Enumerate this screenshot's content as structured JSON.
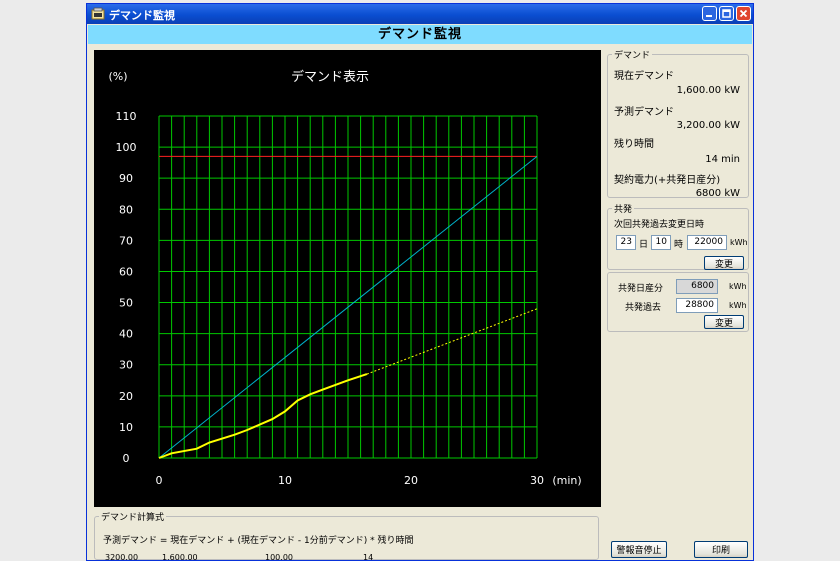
{
  "window": {
    "title": "デマンド監視"
  },
  "header": {
    "title": "デマンド監視"
  },
  "chart_data": {
    "type": "line",
    "title": "デマンド表示",
    "ylabel": "(%)",
    "xlabel": "(min)",
    "xlim": [
      0,
      30
    ],
    "ylim": [
      0,
      110
    ],
    "x_ticks": [
      0,
      10,
      20,
      30
    ],
    "y_ticks": [
      0,
      10,
      20,
      30,
      40,
      50,
      60,
      70,
      80,
      90,
      100,
      110
    ],
    "grid": true,
    "colors": {
      "background": "#000000",
      "grid": "#00c800",
      "limit": "#ff2020",
      "diagonal": "#00b0c8",
      "actual": "#ffff00",
      "projection": "#ffff00",
      "axis_text": "#ffffff"
    },
    "series": [
      {
        "style": "limit",
        "x": [
          0,
          30
        ],
        "y": [
          97,
          97
        ]
      },
      {
        "style": "diagonal",
        "x": [
          0,
          30
        ],
        "y": [
          0,
          97
        ]
      },
      {
        "style": "actual",
        "x": [
          0,
          1,
          3,
          4,
          6,
          7,
          9,
          10,
          11,
          12,
          13,
          14,
          15,
          16.5
        ],
        "y": [
          0,
          1.5,
          3,
          5,
          7.5,
          9,
          12.5,
          15,
          18.5,
          20.5,
          22,
          23.5,
          25,
          27
        ]
      },
      {
        "style": "projection",
        "x": [
          16.5,
          30
        ],
        "y": [
          27,
          48
        ]
      }
    ]
  },
  "demand": {
    "group_label": "デマンド",
    "current_label": "現在デマンド",
    "current_value": "1,600.00  kW",
    "predicted_label": "予測デマンド",
    "predicted_value": "3,200.00  kW",
    "remaining_label": "残り時間",
    "remaining_value": "14  min",
    "contract_label": "契約電力(+共発日産分)",
    "contract_value": "6800  kW"
  },
  "kyohatsu": {
    "group_label": "共発",
    "next_change_label": "次回共発過去変更日時",
    "day_value": "23",
    "day_unit": "日",
    "hour_value": "10",
    "hour_unit": "時",
    "amount_value": "22000",
    "amount_unit": "kWh",
    "change_button": "変更",
    "daily_label": "共発日産分",
    "daily_value": "6800",
    "daily_unit": "kWh",
    "past_label": "共発過去",
    "past_value": "28800",
    "past_unit": "kWh",
    "change_button2": "変更"
  },
  "formula": {
    "group_label": "デマンド計算式",
    "text": "予測デマンド = 現在デマンド + (現在デマンド - 1分前デマンド) * 残り時間",
    "v1": "3200.00",
    "v2": "1,600.00",
    "v3": "100.00",
    "v4": "14"
  },
  "buttons": {
    "alarm_stop": "警報音停止",
    "print": "印刷"
  }
}
